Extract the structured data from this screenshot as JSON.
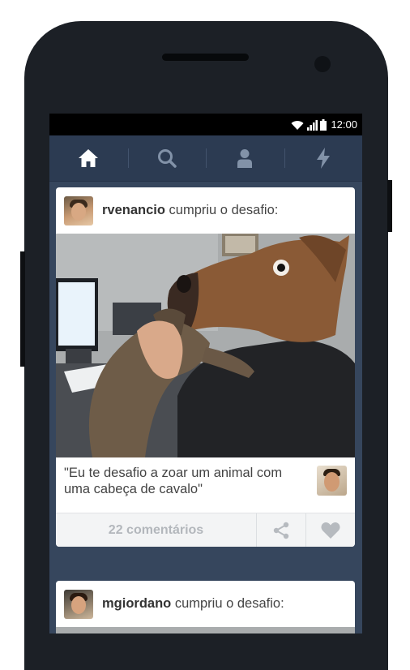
{
  "status_bar": {
    "time": "12:00"
  },
  "nav": {
    "items": [
      {
        "name": "home",
        "icon": "home-icon",
        "active": true
      },
      {
        "name": "search",
        "icon": "search-icon",
        "active": false
      },
      {
        "name": "account",
        "icon": "user-icon",
        "active": false
      },
      {
        "name": "activity",
        "icon": "lightning-icon",
        "active": false
      }
    ]
  },
  "posts": [
    {
      "username": "rvenancio",
      "action": " cumpriu o desafio:",
      "caption": "\"Eu te desafio a zoar um animal com uma cabeça de cavalo\"",
      "comments": "22 comentários"
    },
    {
      "username": "mgiordano",
      "action": " cumpriu o desafio:"
    }
  ],
  "colors": {
    "screen_bg": "#36465d",
    "navbar_bg": "#2c3b52",
    "card_bg": "#ffffff",
    "phone_body": "#1c2026"
  }
}
